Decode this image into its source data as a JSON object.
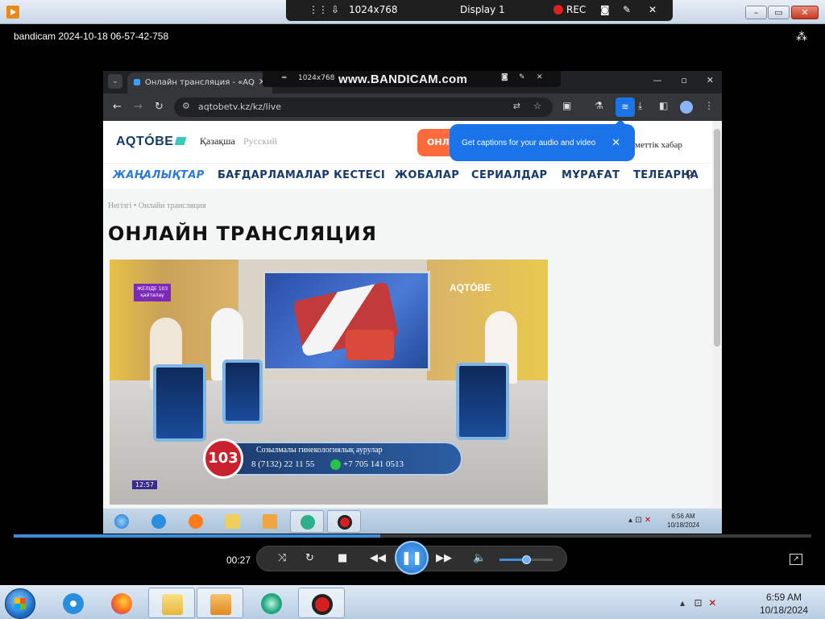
{
  "player": {
    "caption": "bandicam 2024-10-18 06-57-42-758",
    "toolbar": {
      "resolution": "1024x768",
      "display": "Display 1",
      "rec": "REC"
    },
    "elapsed": "00:27",
    "progress_percent": 46,
    "volume_percent": 50
  },
  "browser": {
    "tab_title": "Онлайн трансляция - «AQ",
    "url": "aqtobetv.kz/kz/live",
    "watermark": "www.BANDICAM.com",
    "inner_toolbar_resolution": "1024x768"
  },
  "site": {
    "logo": "AQTÓBE",
    "lang_kz": "Қазақша",
    "lang_ru": "Русский",
    "online_button": "ОНЛ",
    "captions_toast": "Get captions for your audio and video",
    "header_extra": "меттік хабар",
    "nav": [
      "ЖАҢАЛЫҚТАР",
      "БАҒДАРЛАМАЛАР КЕСТЕСІ",
      "ЖОБАЛАР",
      "СЕРИАЛДАР",
      "МҰРАҒАТ",
      "ТЕЛЕАРНА"
    ],
    "breadcrumb_home": "Негізгі",
    "breadcrumb_current": "Онлайн трансляция",
    "page_title": "ОНЛАЙН ТРАНСЛЯЦИЯ"
  },
  "video": {
    "channel_logo": "AQTÓBE",
    "live_badge_line1": "ЖЕЛІДЕ 103",
    "live_badge_line2": "қайталау",
    "lower_third_number": "103",
    "lower_third_title": "Созылмалы гинекологиялық аурулар",
    "phone1": "8 (7132) 22 11 55",
    "phone2": "+7 705 141 0513",
    "clock": "12:57"
  },
  "inner_taskbar": {
    "time": "6:56 AM",
    "date": "10/18/2024"
  },
  "taskbar": {
    "time": "6:59 AM",
    "date": "10/18/2024"
  },
  "colors": {
    "accent_blue": "#1a73e8",
    "orange": "#ff6a3d",
    "navy": "#163a6b"
  }
}
